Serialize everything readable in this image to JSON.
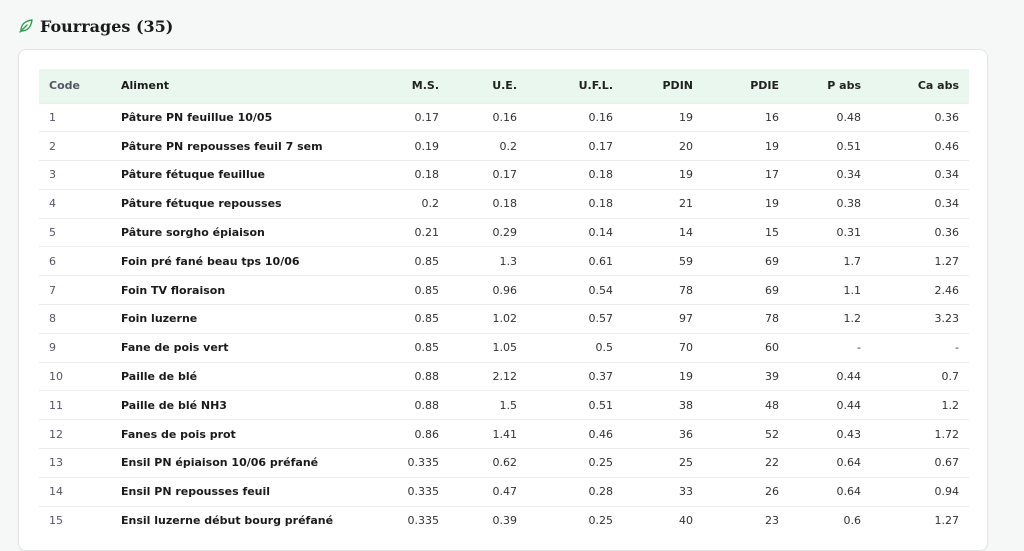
{
  "section": {
    "icon": "leaf-icon",
    "title": "Fourrages (35)",
    "accent_color": "#2e9e4f"
  },
  "table": {
    "header_bg": "#eaf7ee",
    "columns": [
      "Code",
      "Aliment",
      "M.S.",
      "U.E.",
      "U.F.L.",
      "PDIN",
      "PDIE",
      "P abs",
      "Ca abs"
    ],
    "rows": [
      [
        "1",
        "Pâture PN feuillue 10/05",
        "0.17",
        "0.16",
        "0.16",
        "19",
        "16",
        "0.48",
        "0.36"
      ],
      [
        "2",
        "Pâture PN repousses feuil 7 sem",
        "0.19",
        "0.2",
        "0.17",
        "20",
        "19",
        "0.51",
        "0.46"
      ],
      [
        "3",
        "Pâture fétuque feuillue",
        "0.18",
        "0.17",
        "0.18",
        "19",
        "17",
        "0.34",
        "0.34"
      ],
      [
        "4",
        "Pâture fétuque repousses",
        "0.2",
        "0.18",
        "0.18",
        "21",
        "19",
        "0.38",
        "0.34"
      ],
      [
        "5",
        "Pâture sorgho épiaison",
        "0.21",
        "0.29",
        "0.14",
        "14",
        "15",
        "0.31",
        "0.36"
      ],
      [
        "6",
        "Foin pré fané beau tps 10/06",
        "0.85",
        "1.3",
        "0.61",
        "59",
        "69",
        "1.7",
        "1.27"
      ],
      [
        "7",
        "Foin TV floraison",
        "0.85",
        "0.96",
        "0.54",
        "78",
        "69",
        "1.1",
        "2.46"
      ],
      [
        "8",
        "Foin luzerne",
        "0.85",
        "1.02",
        "0.57",
        "97",
        "78",
        "1.2",
        "3.23"
      ],
      [
        "9",
        "Fane de pois vert",
        "0.85",
        "1.05",
        "0.5",
        "70",
        "60",
        "-",
        "-"
      ],
      [
        "10",
        "Paille de blé",
        "0.88",
        "2.12",
        "0.37",
        "19",
        "39",
        "0.44",
        "0.7"
      ],
      [
        "11",
        "Paille de blé NH3",
        "0.88",
        "1.5",
        "0.51",
        "38",
        "48",
        "0.44",
        "1.2"
      ],
      [
        "12",
        "Fanes de pois prot",
        "0.86",
        "1.41",
        "0.46",
        "36",
        "52",
        "0.43",
        "1.72"
      ],
      [
        "13",
        "Ensil PN épiaison 10/06 préfané",
        "0.335",
        "0.62",
        "0.25",
        "25",
        "22",
        "0.64",
        "0.67"
      ],
      [
        "14",
        "Ensil PN repousses feuil",
        "0.335",
        "0.47",
        "0.28",
        "33",
        "26",
        "0.64",
        "0.94"
      ],
      [
        "15",
        "Ensil luzerne début bourg préfané",
        "0.335",
        "0.39",
        "0.25",
        "40",
        "23",
        "0.6",
        "1.27"
      ]
    ]
  }
}
